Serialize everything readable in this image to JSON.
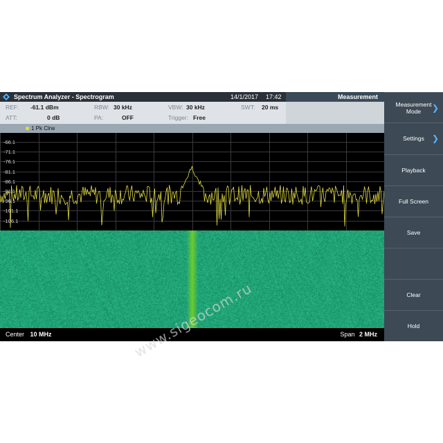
{
  "app": {
    "title": "Spectrum Analyzer - Spectrogram",
    "date": "14/1/2017",
    "time": "17:42",
    "panel": "Measurement"
  },
  "params": {
    "ref_key": "REF:",
    "ref_val": "-61.1 dBm",
    "att_key": "ATT:",
    "att_val": "0 dB",
    "rbw_key": "RBW:",
    "rbw_val": "30 kHz",
    "pa_key": "PA:",
    "pa_val": "OFF",
    "vbw_key": "VBW:",
    "vbw_val": "30 kHz",
    "trigger_key": "Trigger:",
    "trigger_val": "Free",
    "swt_key": "SWT:",
    "swt_val": "20 ms"
  },
  "trace": {
    "label": "1 Pk Clrw",
    "color": "#e6e043"
  },
  "spectrum": {
    "y_labels": [
      "-66.1",
      "-71.1",
      "-76.1",
      "-81.1",
      "-86.1",
      "-91.1",
      "-96.1",
      "-101.1",
      "-106.1"
    ],
    "ref_level_dbm": -61.1,
    "db_per_div": 5,
    "noise_floor_dbm": -93,
    "signal_peak_dbm": -79,
    "signal_position": 0.5
  },
  "footer": {
    "center_key": "Center",
    "center_val": "10 MHz",
    "span_key": "Span",
    "span_val": "2 MHz"
  },
  "softkeys": [
    {
      "label": "Measurement Mode",
      "arrow": true
    },
    {
      "label": "Settings",
      "arrow": true
    },
    {
      "label": "Playback",
      "arrow": false
    },
    {
      "label": "Full Screen",
      "arrow": false
    },
    {
      "label": "Save",
      "arrow": false
    },
    {
      "label": "",
      "arrow": false
    },
    {
      "label": "Clear",
      "arrow": false
    },
    {
      "label": "Hold",
      "arrow": false
    }
  ],
  "arrow_glyph": "❯",
  "watermark": "www.sigeocom.ru",
  "colors": {
    "accent": "#5ab4ff",
    "trace": "#e6e043",
    "waterfall": "#1a9f6e",
    "waterfall_signal": "#6fcf2a"
  }
}
